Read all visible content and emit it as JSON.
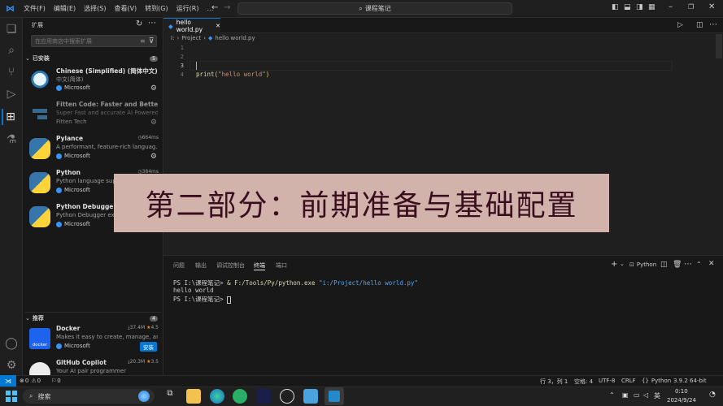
{
  "titlebar": {
    "menu": [
      "文件(F)",
      "编辑(E)",
      "选择(S)",
      "查看(V)",
      "转到(G)",
      "运行(R)"
    ],
    "more": "…",
    "command_center": "课程笔记"
  },
  "sidebar": {
    "title": "扩展",
    "search_placeholder": "在应用商店中搜索扩展",
    "installed_label": "已安装",
    "installed_count": "5",
    "installed": [
      {
        "name": "Chinese (Simplified) (简体中文) L...",
        "desc": "中文(简体)",
        "publisher": "Microsoft"
      },
      {
        "name": "Fitten Code: Faster and Better AI ...",
        "desc": "Super Fast and accurate AI Powered...",
        "publisher": "Fitten Tech"
      },
      {
        "name": "Pylance",
        "meta": "664ms",
        "desc": "A performant, feature-rich languag...",
        "publisher": "Microsoft"
      },
      {
        "name": "Python",
        "meta": "384ms",
        "desc": "Python language sup",
        "publisher": "Microsoft"
      },
      {
        "name": "Python Debugger",
        "desc": "Python Debugger ext",
        "publisher": "Microsoft"
      }
    ],
    "recommended_label": "推荐",
    "recommended_count": "4",
    "recommended": [
      {
        "name": "Docker",
        "downloads": "37.4M",
        "rating": "4.5",
        "desc": "Makes it easy to create, manage, an...",
        "publisher": "Microsoft",
        "action": "安装",
        "logo_text": "docker"
      },
      {
        "name": "GitHub Copilot",
        "downloads": "20.3M",
        "rating": "3.5",
        "desc": "Your AI pair programmer"
      }
    ]
  },
  "editor": {
    "tab_label": "hello world.py",
    "breadcrumb": [
      "I:",
      "Project",
      "hello world.py"
    ],
    "line_numbers": [
      "1",
      "2",
      "3",
      "4"
    ],
    "code_fn": "print",
    "code_open": "(",
    "code_string": "\"hello world\"",
    "code_close": ")"
  },
  "panel": {
    "tabs": [
      "问题",
      "输出",
      "调试控制台",
      "终端",
      "端口"
    ],
    "active_tab": "终端",
    "shell": "Python",
    "prompt1": "PS I:\\课程笔记> ",
    "cmd_amp": "& ",
    "cmd_exe": "F:/Tools/Py/python.exe",
    "cmd_arg": "\"i:/Project/hello world.py\"",
    "output": "hello world",
    "prompt2": "PS I:\\课程笔记> "
  },
  "statusbar": {
    "errors": "0",
    "warnings": "0",
    "ports": "0",
    "position": "行 3，列 1",
    "spaces": "空格: 4",
    "encoding": "UTF-8",
    "eol": "CRLF",
    "language": "Python",
    "interpreter": "3.9.2 64-bit"
  },
  "taskbar": {
    "search": "搜索",
    "ime": "英",
    "time": "0:10",
    "date": "2024/9/24"
  },
  "banner": {
    "text": "第二部分：前期准备与基础配置"
  },
  "colors": {
    "accent": "#0078d4",
    "string": "#ce9178",
    "function": "#dcdcaa",
    "banner_bg": "#d7b8b1",
    "banner_text": "#3b0e1e"
  }
}
